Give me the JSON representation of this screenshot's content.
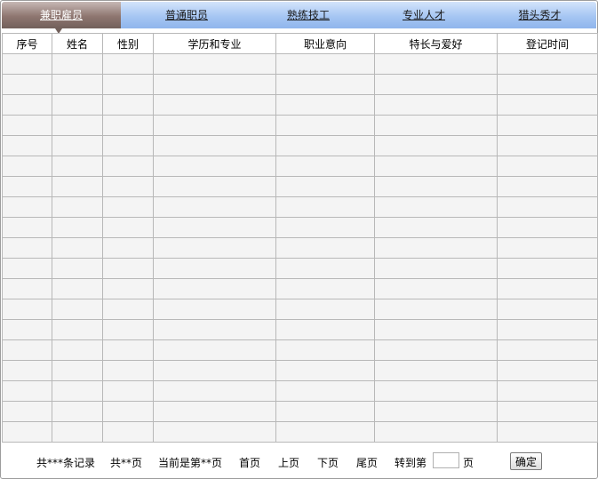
{
  "tabs": [
    {
      "label": "兼职雇员",
      "active": true
    },
    {
      "label": "普通职员",
      "active": false
    },
    {
      "label": "熟练技工",
      "active": false
    },
    {
      "label": "专业人才",
      "active": false
    },
    {
      "label": "猎头秀才",
      "active": false
    }
  ],
  "table": {
    "columns": [
      "序号",
      "姓名",
      "性别",
      "学历和专业",
      "职业意向",
      "特长与爱好",
      "登记时间"
    ],
    "row_count": 19
  },
  "pager": {
    "total_records": "共***条记录",
    "total_pages": "共**页",
    "current_page": "当前是第**页",
    "first": "首页",
    "prev": "上页",
    "next": "下页",
    "last": "尾页",
    "goto_label": "转到第",
    "goto_suffix": "页",
    "goto_value": "",
    "confirm": "确定"
  },
  "colors": {
    "tabbar": "#a6c6f3",
    "active_tab": "#8e7670",
    "cell_bg": "#f4f4f4",
    "grid_line": "#b8b8b8"
  }
}
